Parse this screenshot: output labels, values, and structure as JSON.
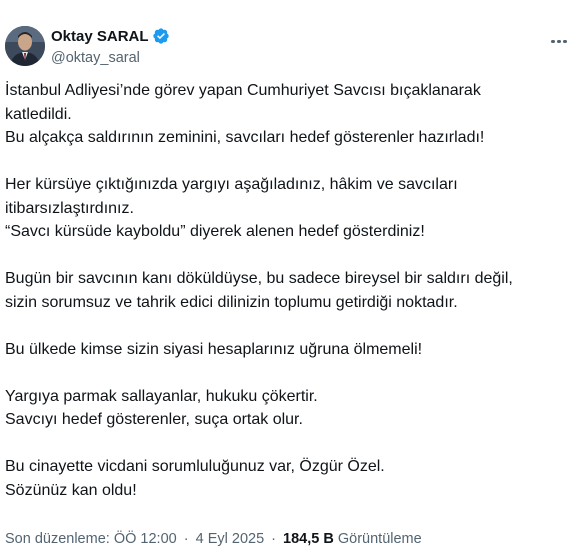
{
  "author": {
    "name": "Oktay SARAL",
    "handle": "@oktay_saral",
    "verified_icon": "verified-badge-icon",
    "verified_color": "#1d9bf0"
  },
  "tweet": {
    "lines": [
      "İstanbul Adliyesi’nde görev yapan Cumhuriyet Savcısı bıçaklanarak",
      "katledildi.",
      "Bu alçakça saldırının zeminini, savcıları hedef gösterenler hazırladı!",
      "",
      "Her kürsüye çıktığınızda yargıyı aşağıladınız, hâkim ve savcıları",
      "itibarsızlaştırdınız.",
      "“Savcı kürsüde kayboldu” diyerek alenen hedef gösterdiniz!",
      "",
      "Bugün bir savcının kanı döküldüyse, bu sadece bireysel bir saldırı değil,",
      "sizin sorumsuz ve tahrik edici dilinizin toplumu getirdiği noktadır.",
      "",
      "Bu ülkede kimse sizin siyasi hesaplarınız uğruna ölmemeli!",
      "",
      "Yargıya parmak sallayanlar, hukuku çökertir.",
      "Savcıyı hedef gösterenler, suça ortak olur.",
      "",
      "Bu cinayette vicdani sorumluluğunuz var, Özgür Özel.",
      "Sözünüz kan oldu!"
    ]
  },
  "meta": {
    "edited_label": "Son düzenleme: ÖÖ 12:00",
    "separator": "·",
    "date": "4 Eyl 2025",
    "views_count": "184,5 B",
    "views_label": "Görüntüleme"
  }
}
